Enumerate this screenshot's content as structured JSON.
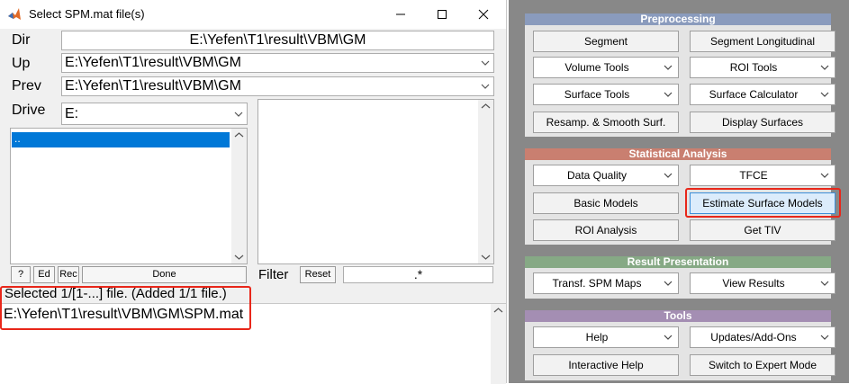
{
  "dialog": {
    "title": "Select SPM.mat file(s)",
    "dir_label": "Dir",
    "dir_value": "E:\\Yefen\\T1\\result\\VBM\\GM",
    "up_label": "Up",
    "up_value": "E:\\Yefen\\T1\\result\\VBM\\GM",
    "prev_label": "Prev",
    "prev_value": "E:\\Yefen\\T1\\result\\VBM\\GM",
    "drive_label": "Drive",
    "drive_value": "E:",
    "dir_list": [
      ".."
    ],
    "buttons": {
      "help": "?",
      "edit": "Ed",
      "rec": "Rec",
      "done": "Done",
      "reset": "Reset"
    },
    "filter_label": "Filter",
    "filter_value": ".*",
    "status": "Selected 1/[1-...] file. (Added 1/1 file.)",
    "selected_file": "E:\\Yefen\\T1\\result\\VBM\\GM\\SPM.mat"
  },
  "panel": {
    "preprocessing": {
      "header": "Preprocessing",
      "color": "#8a9bbd",
      "segment": "Segment",
      "segment_longitudinal": "Segment Longitudinal",
      "volume_tools": "Volume Tools",
      "roi_tools": "ROI Tools",
      "surface_tools": "Surface Tools",
      "surface_calculator": "Surface Calculator",
      "resamp_smooth": "Resamp. & Smooth Surf.",
      "display_surfaces": "Display Surfaces"
    },
    "statistical": {
      "header": "Statistical Analysis",
      "color": "#c97f70",
      "data_quality": "Data Quality",
      "tfce": "TFCE",
      "basic_models": "Basic Models",
      "estimate_surface_models": "Estimate Surface Models",
      "roi_analysis": "ROI Analysis",
      "get_tiv": "Get TIV"
    },
    "results": {
      "header": "Result Presentation",
      "color": "#86a985",
      "transf_spm_maps": "Transf. SPM Maps",
      "view_results": "View Results"
    },
    "tools": {
      "header": "Tools",
      "color": "#a48eb3",
      "help": "Help",
      "updates": "Updates/Add-Ons",
      "interactive_help": "Interactive Help",
      "switch_expert": "Switch to Expert Mode"
    }
  }
}
